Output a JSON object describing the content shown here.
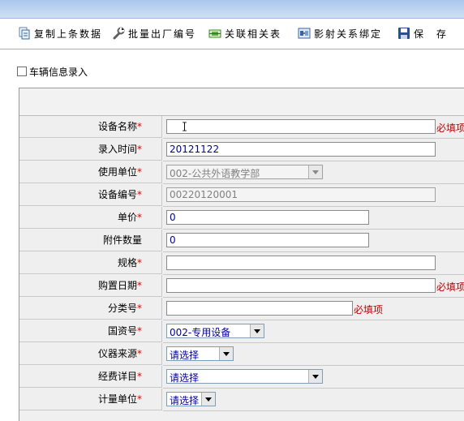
{
  "toolbar": {
    "buttons": [
      {
        "label": "复制上条数据",
        "icon": "copy-document-icon"
      },
      {
        "label": "批量出厂编号",
        "icon": "wrench-icon"
      },
      {
        "label": "关联相关表",
        "icon": "link-table-icon"
      },
      {
        "label": "影射关系绑定",
        "icon": "mapping-icon"
      },
      {
        "label": "保 存",
        "icon": "floppy-disk-icon"
      }
    ]
  },
  "section": {
    "title": "车辆信息录入"
  },
  "required_hint": "必填项",
  "fields": [
    {
      "label": "设备名称",
      "required": true,
      "value": "",
      "type": "text"
    },
    {
      "label": "录入时间",
      "required": true,
      "value": "20121122",
      "type": "text"
    },
    {
      "label": "使用单位",
      "required": true,
      "value": "002-公共外语教学部",
      "type": "select-readonly"
    },
    {
      "label": "设备编号",
      "required": true,
      "value": "00220120001",
      "type": "text-readonly"
    },
    {
      "label": "单价",
      "required": true,
      "value": "0",
      "type": "text"
    },
    {
      "label": "附件数量",
      "required": false,
      "value": "0",
      "type": "text"
    },
    {
      "label": "规格",
      "required": true,
      "value": "",
      "type": "text"
    },
    {
      "label": "购置日期",
      "required": true,
      "value": "",
      "type": "text"
    },
    {
      "label": "分类号",
      "required": true,
      "value": "",
      "type": "text"
    },
    {
      "label": "国资号",
      "required": true,
      "value": "002-专用设备",
      "type": "select"
    },
    {
      "label": "仪器来源",
      "required": true,
      "value": "请选择",
      "type": "select"
    },
    {
      "label": "经费详目",
      "required": true,
      "value": "请选择",
      "type": "select"
    },
    {
      "label": "计量单位",
      "required": true,
      "value": "请选择",
      "type": "select"
    }
  ],
  "colors": {
    "required_star": "#e00000",
    "required_hint": "#c00000",
    "value_text": "#0000a0",
    "header_band": "#a9c7ec"
  }
}
